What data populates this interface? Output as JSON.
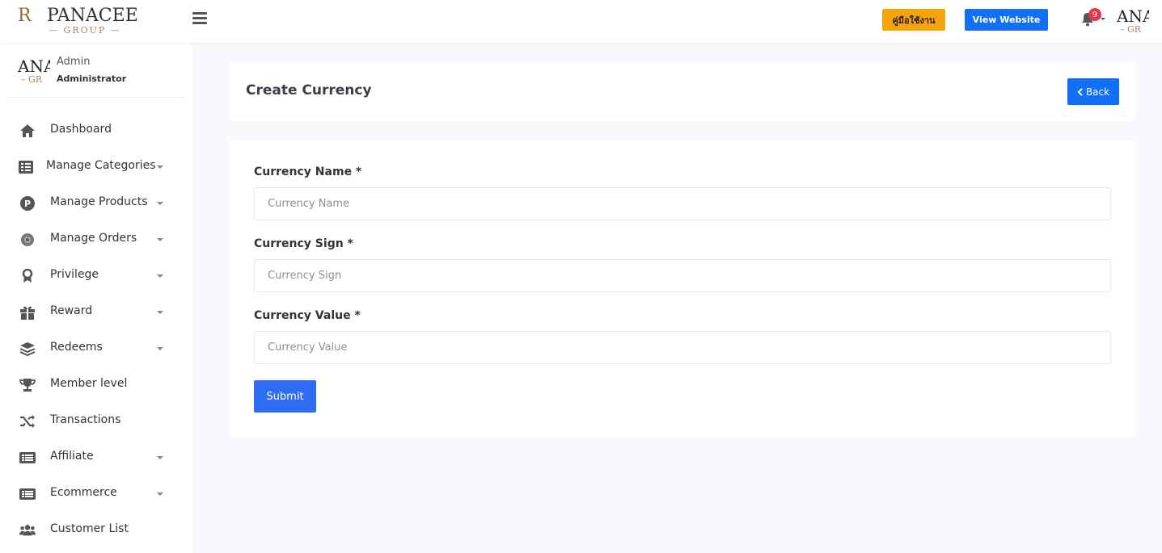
{
  "header": {
    "logo_mark": "R",
    "logo_name": "PANACEE",
    "logo_sub": "— GROUP —",
    "manual_label": "คู่มือใช้งาน",
    "view_website_label": "View Website",
    "notification_count": "9",
    "avatar_text": "ANA",
    "avatar_sub": "– GR"
  },
  "sidebar": {
    "user": {
      "avatar_text": "ANA",
      "avatar_sub": "– GR",
      "name": "Admin",
      "role": "Administrator"
    },
    "items": [
      {
        "label": "Dashboard",
        "icon": "home-icon",
        "has_caret": false
      },
      {
        "label": "Manage Categories",
        "icon": "list-icon",
        "has_caret": true
      },
      {
        "label": "Manage Products",
        "icon": "product-p-icon",
        "has_caret": true
      },
      {
        "label": "Manage Orders",
        "icon": "orders-icon",
        "has_caret": true
      },
      {
        "label": "Privilege",
        "icon": "award-icon",
        "has_caret": true
      },
      {
        "label": "Reward",
        "icon": "gift-icon",
        "has_caret": true
      },
      {
        "label": "Redeems",
        "icon": "layers-icon",
        "has_caret": true
      },
      {
        "label": "Member level",
        "icon": "trophy-icon",
        "has_caret": false
      },
      {
        "label": "Transactions",
        "icon": "shuffle-icon",
        "has_caret": false
      },
      {
        "label": "Affiliate",
        "icon": "card-list-icon",
        "has_caret": true
      },
      {
        "label": "Ecommerce",
        "icon": "card-list-icon",
        "has_caret": true
      },
      {
        "label": "Customer List",
        "icon": "users-icon",
        "has_caret": false
      }
    ]
  },
  "main": {
    "title": "Create Currency",
    "back_label": "Back",
    "fields": [
      {
        "label": "Currency Name *",
        "placeholder": "Currency Name",
        "value": ""
      },
      {
        "label": "Currency Sign *",
        "placeholder": "Currency Sign",
        "value": ""
      },
      {
        "label": "Currency Value *",
        "placeholder": "Currency Value",
        "value": ""
      }
    ],
    "submit_label": "Submit"
  },
  "colors": {
    "primary": "#1170f6",
    "submit": "#2f6cf6",
    "manual": "#f6a30c",
    "badge": "#e8334a",
    "background": "#f8f9fc"
  }
}
